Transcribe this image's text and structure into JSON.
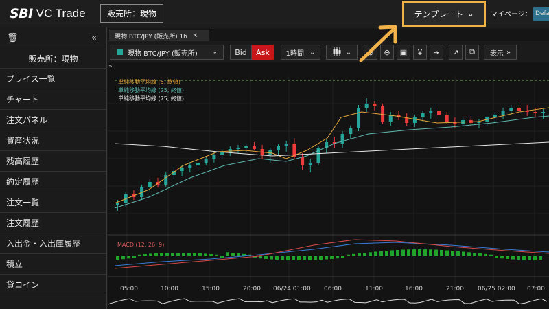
{
  "header": {
    "logo_sbi": "SBI",
    "logo_vc": "VC Trade",
    "market_label": "販売所：現物",
    "template_label": "テンプレート",
    "mypage_label": "マイページ：",
    "default_badge": "Defa"
  },
  "sidebar": {
    "market_title": "販売所：現物",
    "items": [
      {
        "label": "プライス一覧"
      },
      {
        "label": "チャート"
      },
      {
        "label": "注文パネル"
      },
      {
        "label": "資産状況"
      },
      {
        "label": "残高履歴"
      },
      {
        "label": "約定履歴"
      },
      {
        "label": "注文一覧"
      },
      {
        "label": "注文履歴"
      },
      {
        "label": "入出金・入出庫履歴"
      },
      {
        "label": "積立"
      },
      {
        "label": "貸コイン"
      }
    ]
  },
  "tab": {
    "label": "現物 BTC/JPY (販売所) 1h"
  },
  "toolbar": {
    "symbol": "現物 BTC/JPY (販売所)",
    "bid": "Bid",
    "ask": "Ask",
    "timeframe": "1時間",
    "display": "表示"
  },
  "chart": {
    "legend": [
      {
        "text": "単純移動平均線 (5, 終値)",
        "color": "#e3a53a"
      },
      {
        "text": "単純移動平均線 (25, 終値)",
        "color": "#5fb8b0"
      },
      {
        "text": "単純移動平均線 (75, 終値)",
        "color": "#e6e6e6"
      }
    ],
    "macd_label": "MACD (12, 26, 9)",
    "time_labels": [
      "05:00",
      "10:00",
      "15:00",
      "20:00",
      "06/24 01:00",
      "06:00",
      "11:00",
      "16:00",
      "21:00",
      "06/25 02:00",
      "07:00"
    ]
  },
  "colors": {
    "up": "#26a69a",
    "down": "#ef3b3b",
    "accent_highlight": "#f2b24a",
    "ask": "#c8161d"
  }
}
